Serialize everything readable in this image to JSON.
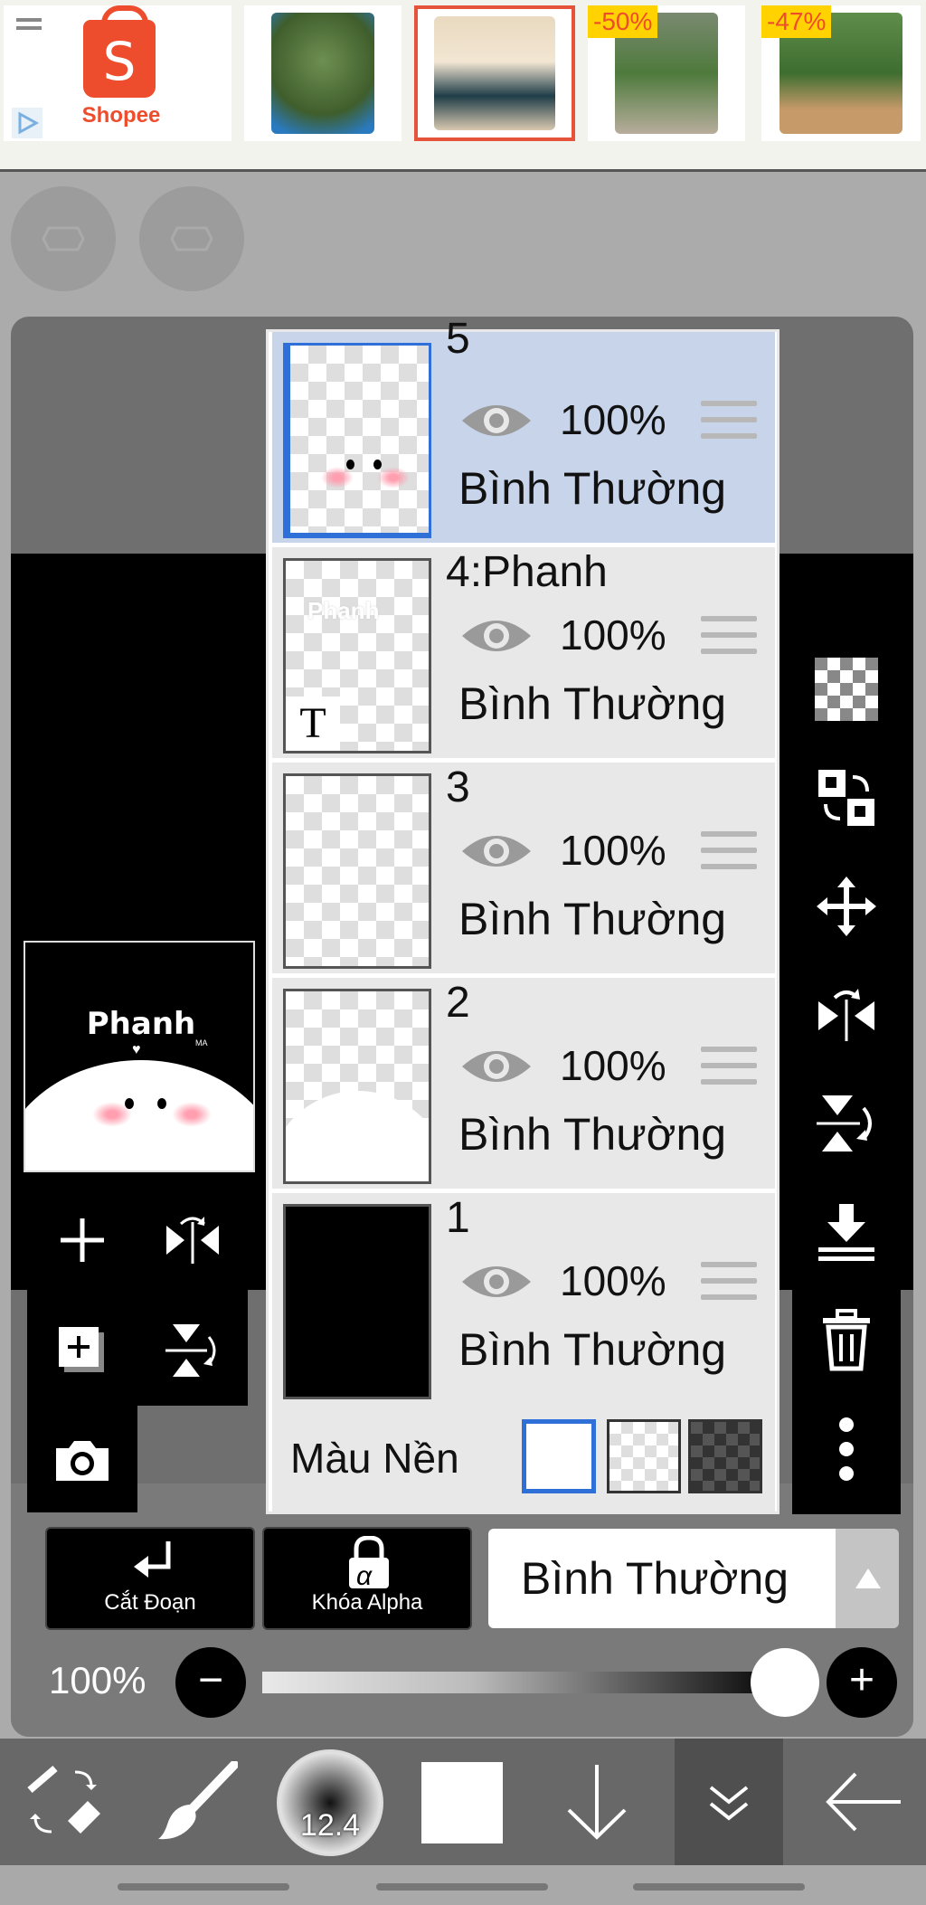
{
  "ad": {
    "brand": "Shopee",
    "brand_letter": "S",
    "products": [
      {
        "badge": ""
      },
      {
        "badge": ""
      },
      {
        "badge": "-50%"
      },
      {
        "badge": "-47%"
      }
    ]
  },
  "preview": {
    "title": "Phanh",
    "small_tag": "MA"
  },
  "layers": [
    {
      "name": "5",
      "opacity": "100%",
      "blend": "Bình Thường",
      "selected": true
    },
    {
      "name": "4:Phanh",
      "opacity": "100%",
      "blend": "Bình Thường",
      "selected": false,
      "thumb_text": "Phanh",
      "type_marker": "T"
    },
    {
      "name": "3",
      "opacity": "100%",
      "blend": "Bình Thường",
      "selected": false
    },
    {
      "name": "2",
      "opacity": "100%",
      "blend": "Bình Thường",
      "selected": false
    },
    {
      "name": "1",
      "opacity": "100%",
      "blend": "Bình Thường",
      "selected": false
    }
  ],
  "background": {
    "label": "Màu Nền",
    "selected": "white"
  },
  "controls": {
    "clip_label": "Cắt Đoạn",
    "alpha_lock_label": "Khóa Alpha",
    "alpha_symbol": "α",
    "blend_mode": "Bình Thường",
    "opacity_label": "100%",
    "minus": "−",
    "plus": "+"
  },
  "toolbar": {
    "brush_size": "12.4",
    "color": "#ffffff"
  },
  "colors": {
    "accent_blue": "#2e6fd8",
    "selected_row": "#c8d4ea",
    "row_bg": "#e8e8e8"
  }
}
